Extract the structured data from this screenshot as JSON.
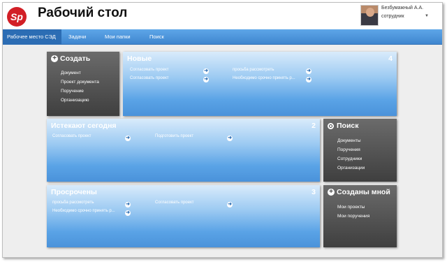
{
  "header": {
    "logo_text": "Sp",
    "title": "Рабочий стол",
    "user_name": "Безбумажный А.А.",
    "user_role": "сотрудник",
    "user_menu_icon": "caret-down-icon"
  },
  "nav": {
    "items": [
      "Рабочее место СЭД",
      "Задачи",
      "Мои папки",
      "Поиск"
    ],
    "active": "Рабочее место СЭД"
  },
  "colors": {
    "accent": "#3f86cf",
    "logo": "#d21f26",
    "dark_tile": "#4a4a4a"
  },
  "create": {
    "title": "Создать",
    "icon": "plus-circle-icon",
    "items": [
      "Документ",
      "Проект документа",
      "Поручение",
      "Организацию"
    ]
  },
  "new": {
    "title": "Новые",
    "count": "4",
    "tasks": [
      "Согласовать проект",
      "Согласовать проект",
      "просьба рассмотреть",
      "Необходимо срочно принять р..."
    ]
  },
  "today": {
    "title": "Истекают сегодня",
    "count": "2",
    "tasks": [
      "Согласовать проект",
      "Подготовить проект"
    ]
  },
  "overdue": {
    "title": "Просрочены",
    "count": "3",
    "tasks": [
      "просьба рассмотреть",
      "Необходимо срочно принять р...",
      "Согласовать проект"
    ]
  },
  "search": {
    "title": "Поиск",
    "icon": "search-icon",
    "items": [
      "Документы",
      "Поручения",
      "Сотрудники",
      "Организации"
    ]
  },
  "created": {
    "title": "Созданы мной",
    "icon": "plus-circle-icon",
    "items": [
      "Мои проекты",
      "Мои поручения"
    ]
  },
  "task_open_icon": "arrow-right-circle-icon"
}
